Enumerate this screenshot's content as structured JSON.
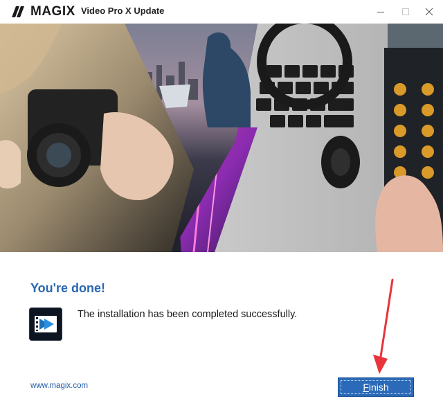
{
  "titlebar": {
    "brand": "MAGIX",
    "app_title": "Video Pro X Update",
    "icons": {
      "minimize": "minimize-icon",
      "maximize": "maximize-icon",
      "close": "close-icon"
    }
  },
  "banner": {
    "description_icons": [
      "camera",
      "city-laptop",
      "light-trails",
      "headphones-keyboard",
      "mixer"
    ]
  },
  "content": {
    "title": "You're done!",
    "message": "The installation has been completed successfully.",
    "app_icon": "video-pro-x-icon",
    "link": "www.magix.com"
  },
  "footer": {
    "finish_first": "F",
    "finish_rest": "inish"
  },
  "colors": {
    "accent": "#2a67b0",
    "button": "#2a6ab8",
    "annotation_arrow": "#e8343a"
  }
}
